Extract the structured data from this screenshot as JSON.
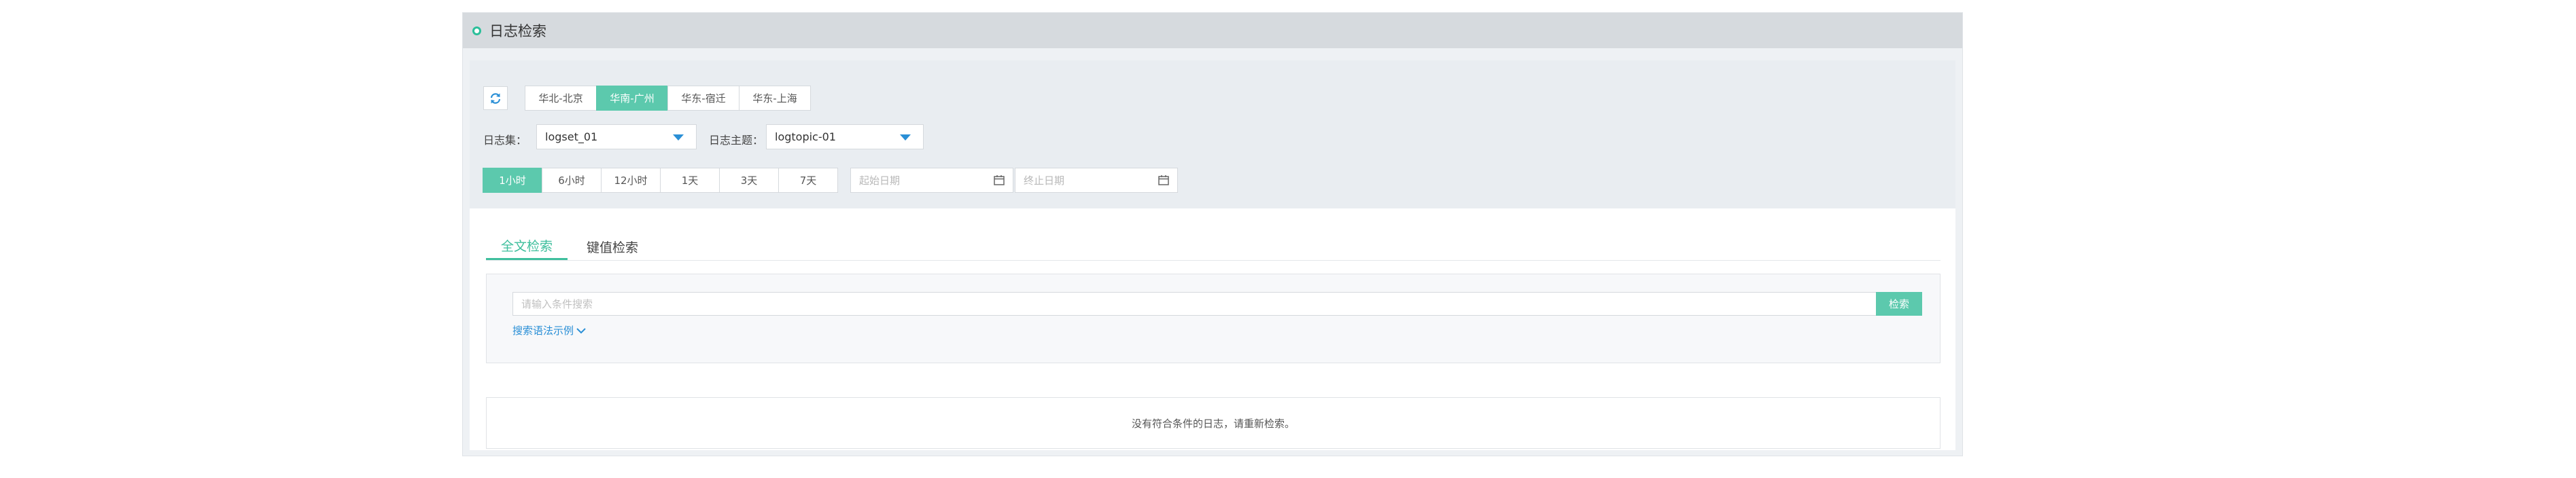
{
  "page": {
    "title": "日志检索"
  },
  "toolbar": {
    "refresh": "refresh-icon"
  },
  "regions": [
    {
      "label": "华北-北京",
      "active": false
    },
    {
      "label": "华南-广州",
      "active": true
    },
    {
      "label": "华东-宿迁",
      "active": false
    },
    {
      "label": "华东-上海",
      "active": false
    }
  ],
  "filters": {
    "logset_label": "日志集：",
    "logset_value": "logset_01",
    "logtopic_label": "日志主题：",
    "logtopic_value": "logtopic-01"
  },
  "time_ranges": [
    {
      "label": "1小时",
      "active": true
    },
    {
      "label": "6小时",
      "active": false
    },
    {
      "label": "12小时",
      "active": false
    },
    {
      "label": "1天",
      "active": false
    },
    {
      "label": "3天",
      "active": false
    },
    {
      "label": "7天",
      "active": false
    }
  ],
  "dates": {
    "start_placeholder": "起始日期",
    "end_placeholder": "终止日期"
  },
  "search_tabs": [
    {
      "label": "全文检索",
      "active": true
    },
    {
      "label": "键值检索",
      "active": false
    }
  ],
  "search": {
    "placeholder": "请输入条件搜索",
    "button": "检索",
    "syntax_link": "搜索语法示例"
  },
  "result": {
    "empty_message": "没有符合条件的日志，请重新检索。"
  },
  "colors": {
    "accent": "#5cc9ad",
    "link": "#2a8fd6"
  }
}
